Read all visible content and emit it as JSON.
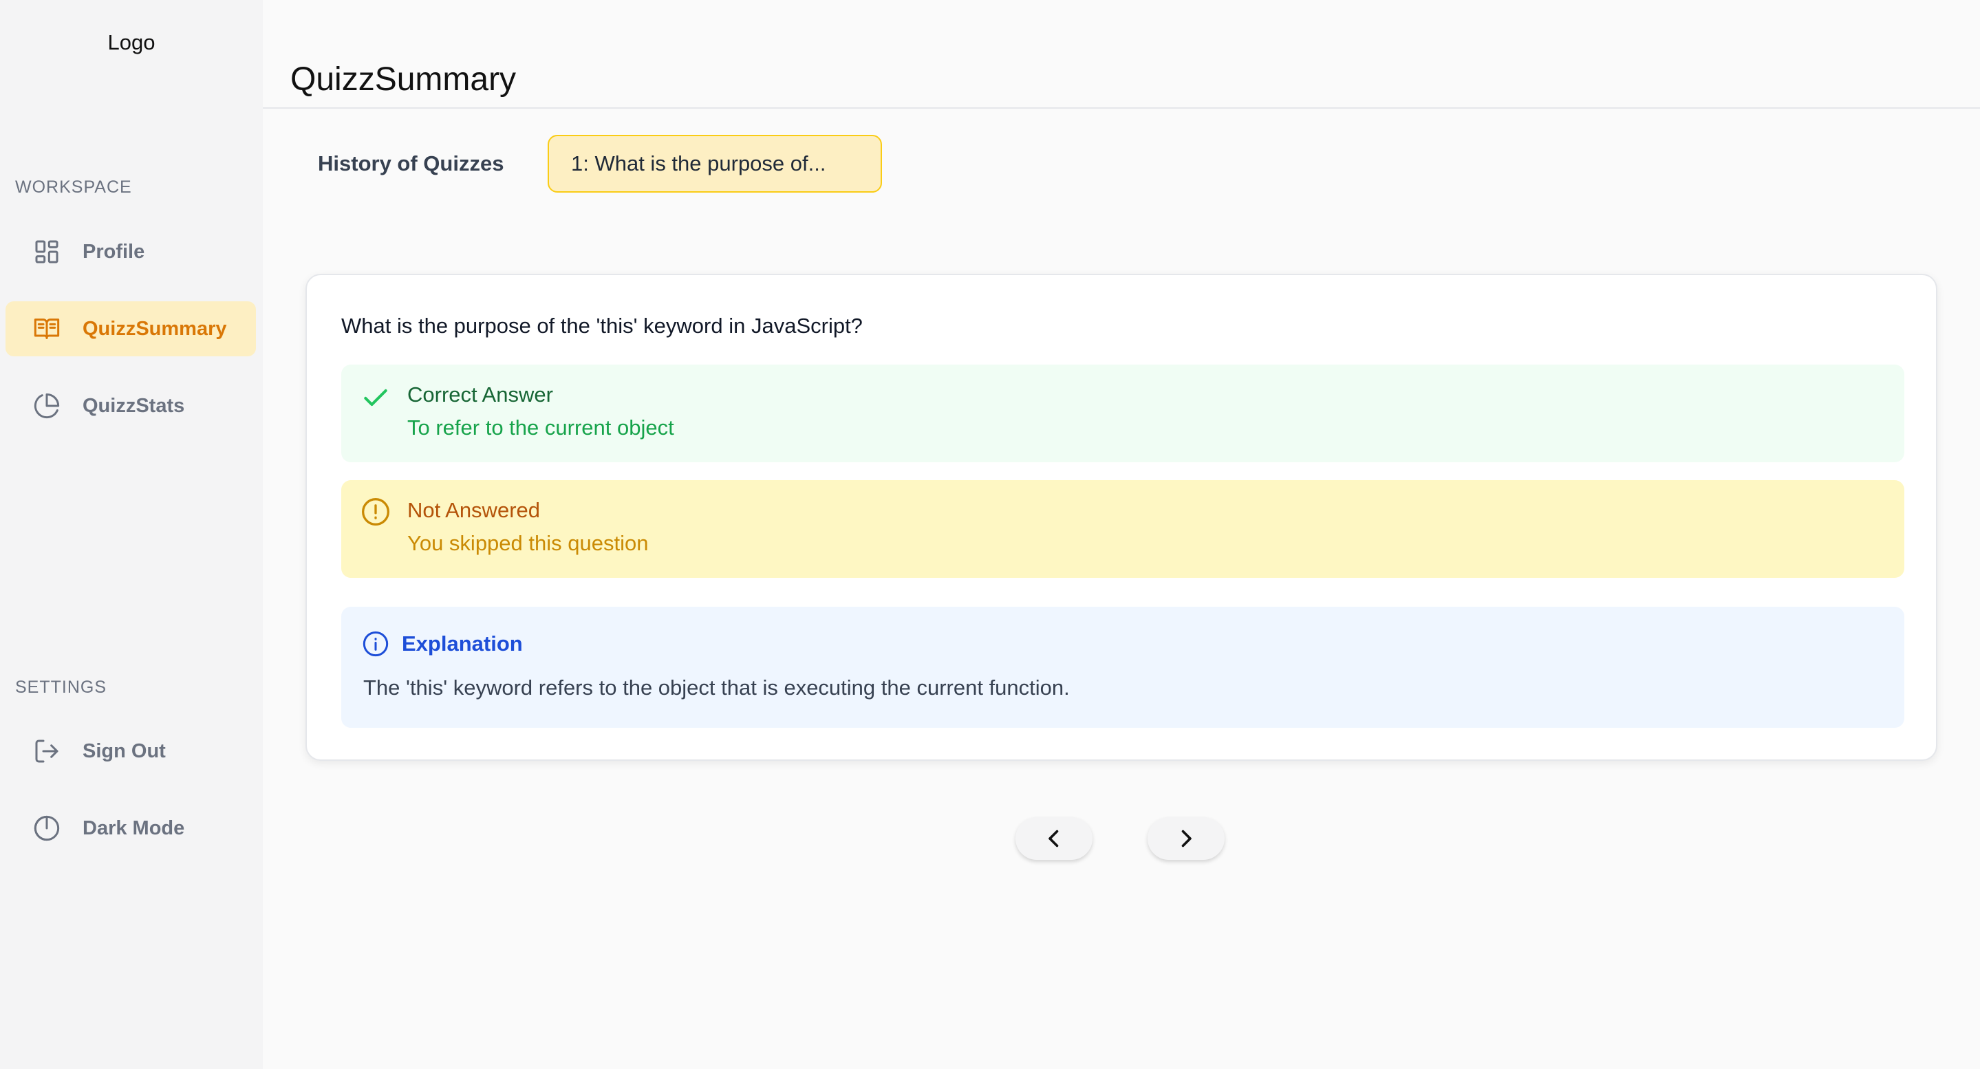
{
  "sidebar": {
    "logo": "Logo",
    "workspace_title": "WORKSPACE",
    "settings_title": "SETTINGS",
    "items": [
      {
        "label": "Profile",
        "icon": "layout-grid-icon",
        "active": false
      },
      {
        "label": "QuizzSummary",
        "icon": "book-open-icon",
        "active": true
      },
      {
        "label": "QuizzStats",
        "icon": "pie-chart-icon",
        "active": false
      }
    ],
    "settings_items": [
      {
        "label": "Sign Out",
        "icon": "log-out-icon"
      },
      {
        "label": "Dark Mode",
        "icon": "moon-icon"
      }
    ]
  },
  "header": {
    "title": "QuizzSummary"
  },
  "history": {
    "label": "History of Quizzes",
    "selected": "1: What is the purpose of..."
  },
  "question": {
    "text": "What is the purpose of the 'this' keyword in JavaScript?",
    "correct": {
      "title": "Correct Answer",
      "text": "To refer to the current object",
      "icon": "check-icon"
    },
    "user_answer": {
      "title": "Not Answered",
      "text": "You skipped this question",
      "icon": "alert-circle-icon"
    },
    "explanation": {
      "title": "Explanation",
      "text": "The 'this' keyword refers to the object that is executing the current function.",
      "icon": "info-icon"
    }
  },
  "pager": {
    "prev_icon": "chevron-left-icon",
    "next_icon": "chevron-right-icon"
  },
  "colors": {
    "accent": "#d97706",
    "active_bg": "#fdefc3",
    "success_bg": "#f0fdf4",
    "warning_bg": "#fef7c3",
    "info_bg": "#eff6ff"
  }
}
